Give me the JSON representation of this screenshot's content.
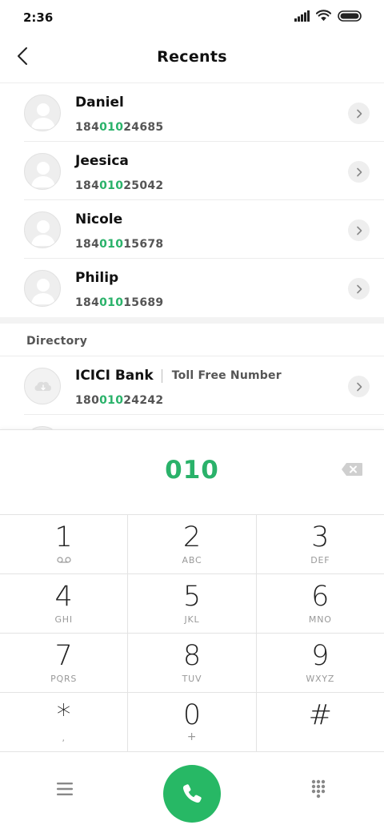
{
  "status_bar": {
    "time": "2:36",
    "icons": [
      "signal-icon",
      "wifi-icon",
      "battery-icon"
    ]
  },
  "header": {
    "title": "Recents",
    "back_icon": "back-arrow-icon"
  },
  "recents": [
    {
      "name": "Daniel",
      "number_prefix": "184",
      "number_match": "010",
      "number_suffix": "24685"
    },
    {
      "name": "Jeesica",
      "number_prefix": "184",
      "number_match": "010",
      "number_suffix": "25042"
    },
    {
      "name": "Nicole",
      "number_prefix": "184",
      "number_match": "010",
      "number_suffix": "15678"
    },
    {
      "name": "Philip",
      "number_prefix": "184",
      "number_match": "010",
      "number_suffix": "15689"
    }
  ],
  "directory": {
    "title": "Directory",
    "items": [
      {
        "name": "ICICI Bank",
        "tag": "Toll Free Number",
        "number_prefix": "180",
        "number_match": "010",
        "number_suffix": "24242"
      }
    ]
  },
  "dialer": {
    "value": "010",
    "keys": [
      [
        {
          "digit": "1",
          "letters": ""
        },
        {
          "digit": "2",
          "letters": "ABC"
        },
        {
          "digit": "3",
          "letters": "DEF"
        }
      ],
      [
        {
          "digit": "4",
          "letters": "GHI"
        },
        {
          "digit": "5",
          "letters": "JKL"
        },
        {
          "digit": "6",
          "letters": "MNO"
        }
      ],
      [
        {
          "digit": "7",
          "letters": "PQRS"
        },
        {
          "digit": "8",
          "letters": "TUV"
        },
        {
          "digit": "9",
          "letters": "WXYZ"
        }
      ],
      [
        {
          "digit": "*",
          "letters": ","
        },
        {
          "digit": "0",
          "letters": "+"
        },
        {
          "digit": "#",
          "letters": ""
        }
      ]
    ]
  },
  "colors": {
    "accent": "#2ab26a",
    "call_button": "#27b865"
  }
}
